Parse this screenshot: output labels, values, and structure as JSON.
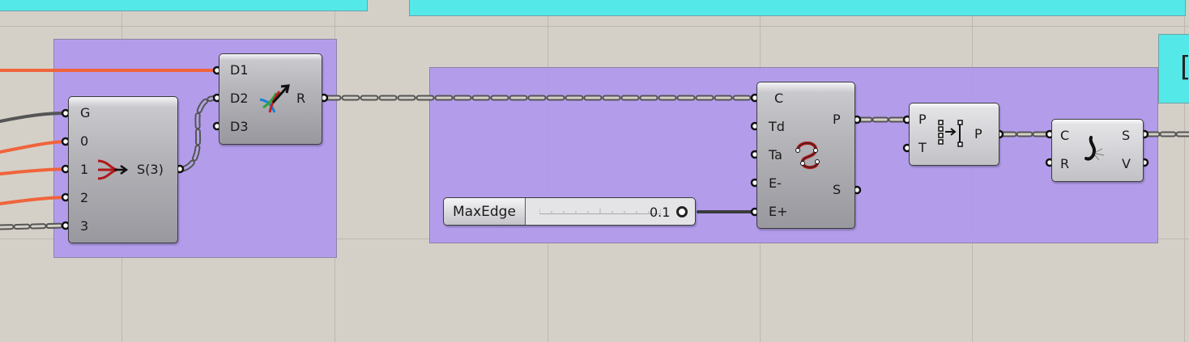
{
  "canvas": {
    "background": "#d4d0c8",
    "group_color": "#b098ee",
    "cyan_color": "#55e8e8",
    "wire_color_orange": "#f0643c",
    "wire_color_dark": "#555555"
  },
  "merge": {
    "inputs": [
      "G",
      "0",
      "1",
      "2",
      "3"
    ],
    "output": "S(3)",
    "icon": "merge-icon"
  },
  "entwine": {
    "inputs": [
      "D1",
      "D2",
      "D3"
    ],
    "output": "R",
    "icon": "entwine-icon"
  },
  "curvature": {
    "inputs": [
      "C",
      "Td",
      "Ta",
      "E-",
      "E+"
    ],
    "outputs": [
      "P",
      "S"
    ],
    "icon": "curvature-graph-icon"
  },
  "partition": {
    "inputs": [
      "P",
      "T"
    ],
    "output": "P",
    "icon": "partition-list-icon"
  },
  "pipe": {
    "inputs": [
      "C",
      "R"
    ],
    "outputs": [
      "S",
      "V"
    ],
    "icon": "pipe-icon"
  },
  "slider": {
    "name": "MaxEdge",
    "value": "0.1"
  },
  "stub_text": "[]"
}
